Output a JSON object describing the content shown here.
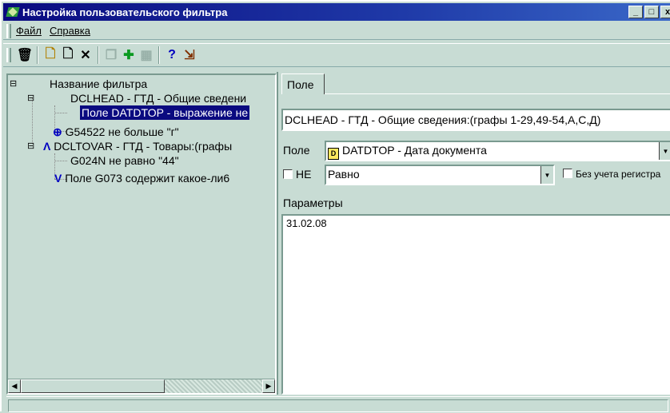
{
  "window": {
    "title": "Настройка пользовательского фильтра",
    "min": "_",
    "max": "□",
    "close": "x"
  },
  "menu": {
    "file": "Файл",
    "help": "Справка"
  },
  "toolbar": {
    "delete": "🗑",
    "new1": "🗋",
    "new2": "🗋",
    "remove": "✕",
    "copy": "❐",
    "add": "✚",
    "grid": "▦",
    "help": "?",
    "exit": "⇲"
  },
  "tree": {
    "root": "Название фильтра",
    "n1": "DCLHEAD   - ГТД - Общие сведени",
    "n1_1": "Поле DATDTOP - выражение не",
    "n1_2": "G54522 не больше \"г\"",
    "n2": "DCLTOVAR  - ГТД - Товары:(графы",
    "n2_1": "G024N не равно \"44\"",
    "n2_2": "Поле G073 содержит какое-ли6",
    "and_op": "Λ",
    "or_op": "V",
    "plus_op": "⊕"
  },
  "right": {
    "tab": "Поле",
    "table_value": "DCLHEAD   - ГТД - Общие сведения:(графы 1-29,49-54,А,С,Д)",
    "field_label": "Поле",
    "field_value": "DATDTOP   - Дата документа",
    "ne_label": "НЕ",
    "op_value": "Равно",
    "case_label": "Без учета регистра",
    "params_label": "Параметры",
    "params_value": "31.02.08"
  }
}
